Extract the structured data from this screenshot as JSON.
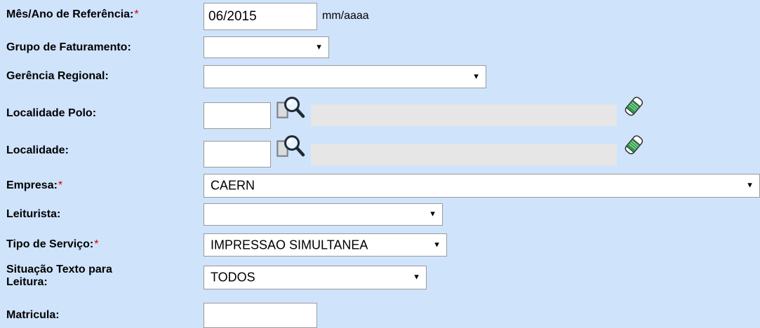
{
  "form": {
    "mes_ano": {
      "label": "Mês/Ano de Referência:",
      "required": "*",
      "value": "06/2015",
      "hint": "mm/aaaa"
    },
    "grupo_faturamento": {
      "label": "Grupo de Faturamento:",
      "value": ""
    },
    "gerencia_regional": {
      "label": "Gerência Regional:",
      "value": ""
    },
    "localidade_polo": {
      "label": "Localidade Polo:",
      "code": "",
      "description": ""
    },
    "localidade": {
      "label": "Localidade:",
      "code": "",
      "description": ""
    },
    "empresa": {
      "label": "Empresa:",
      "required": "*",
      "value": "CAERN"
    },
    "leiturista": {
      "label": "Leiturista:",
      "value": ""
    },
    "tipo_servico": {
      "label": "Tipo de Serviço:",
      "required": "*",
      "value": "IMPRESSAO SIMULTANEA"
    },
    "situacao_texto": {
      "label_line1": "Situação Texto para",
      "label_line2": "Leitura:",
      "value": "TODOS"
    },
    "matricula": {
      "label": "Matricula:",
      "value": ""
    }
  },
  "icons": {
    "search": "magnifier-search-icon",
    "clear": "eraser-clear-icon"
  }
}
